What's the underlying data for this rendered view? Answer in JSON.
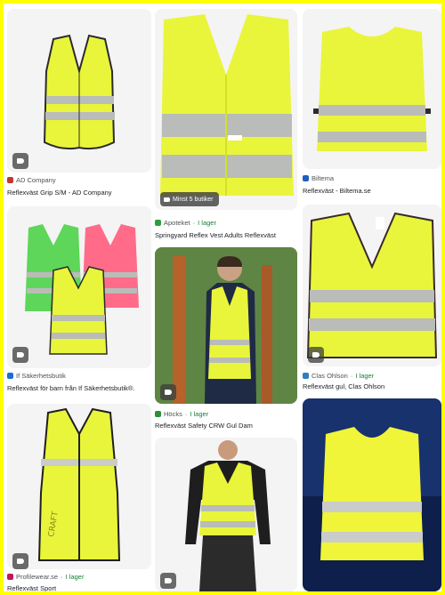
{
  "colors": {
    "vest": "#e9f53a",
    "reflect": "#b9bcb8",
    "trim": "#2b2b2b",
    "in_stock": "#188038"
  },
  "results": [
    {
      "source": "AD Company",
      "title": "Reflexväst Grip S/M - AD Company",
      "favicon": "#c0392b"
    },
    {
      "badge": "Minst 5 butiker",
      "source": "Apoteket",
      "stock": "I lager",
      "title": "Springyard Reflex Vest Adults Reflexväst",
      "favicon": "#2e9e3e"
    },
    {
      "source": "Biltema",
      "title": "Reflexväst - Biltema.se",
      "favicon": "#1f5fbf"
    },
    {
      "source": "If Säkerhetsbutik",
      "title": "Reflexväst för barn från If Säkerhetsbutik®.",
      "favicon": "#1a6fd1"
    },
    {
      "source": "Höcks",
      "stock": "I lager",
      "title": "Reflexväst Safety CRW Gul Dam",
      "favicon": "#2f8f3a"
    },
    {
      "source": "Clas Ohlson",
      "stock": "I lager",
      "title": "Reflexväst gul, Clas Ohlson",
      "favicon": "#2b7fc2"
    },
    {
      "source": "Profilewear.se",
      "stock": "I lager",
      "title": "Reflexväst Sport",
      "favicon": "#c2185b"
    }
  ],
  "icons": {
    "shopping_tag": "tag-icon"
  },
  "separator": " · "
}
